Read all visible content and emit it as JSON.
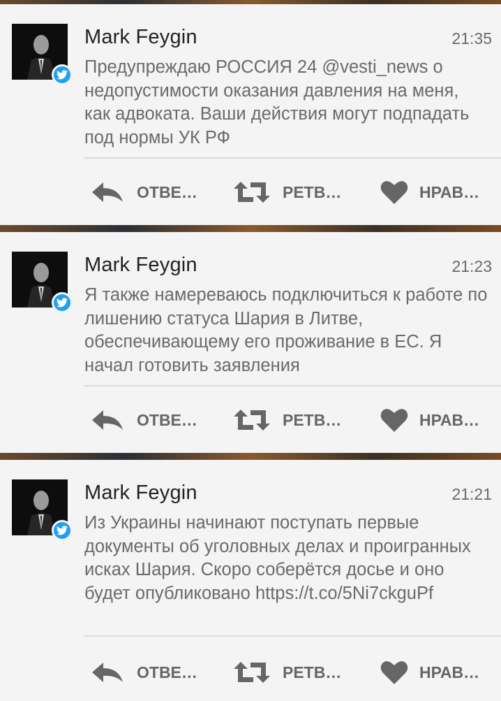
{
  "actions": {
    "reply_label": "ОТВЕ…",
    "retweet_label": "РЕТВ…",
    "like_label": "НРАВ…"
  },
  "tweets": [
    {
      "author": "Mark Feygin",
      "time": "21:35",
      "text": "Предупреждаю РОССИЯ 24 @vesti_news о недопустимости оказания давления на меня, как адвоката. Ваши действия могут подпадать под нормы УК РФ"
    },
    {
      "author": "Mark Feygin",
      "time": "21:23",
      "text": "Я также намереваюсь подключиться к работе по лишению статуса Шария в Литве, обеспечивающему его проживание в ЕС. Я начал готовить заявления"
    },
    {
      "author": "Mark Feygin",
      "time": "21:21",
      "text": "Из Украины начинают поступать первые документы об уголовных делах и проигранных исках Шария. Скоро соберётся досье и оно будет опубликовано https://t.co/5Ni7ckguPf"
    }
  ],
  "colors": {
    "card_bg": "#f4f4f4",
    "text_gray": "#6a6a6a",
    "verified_blue": "#1da1f2"
  }
}
